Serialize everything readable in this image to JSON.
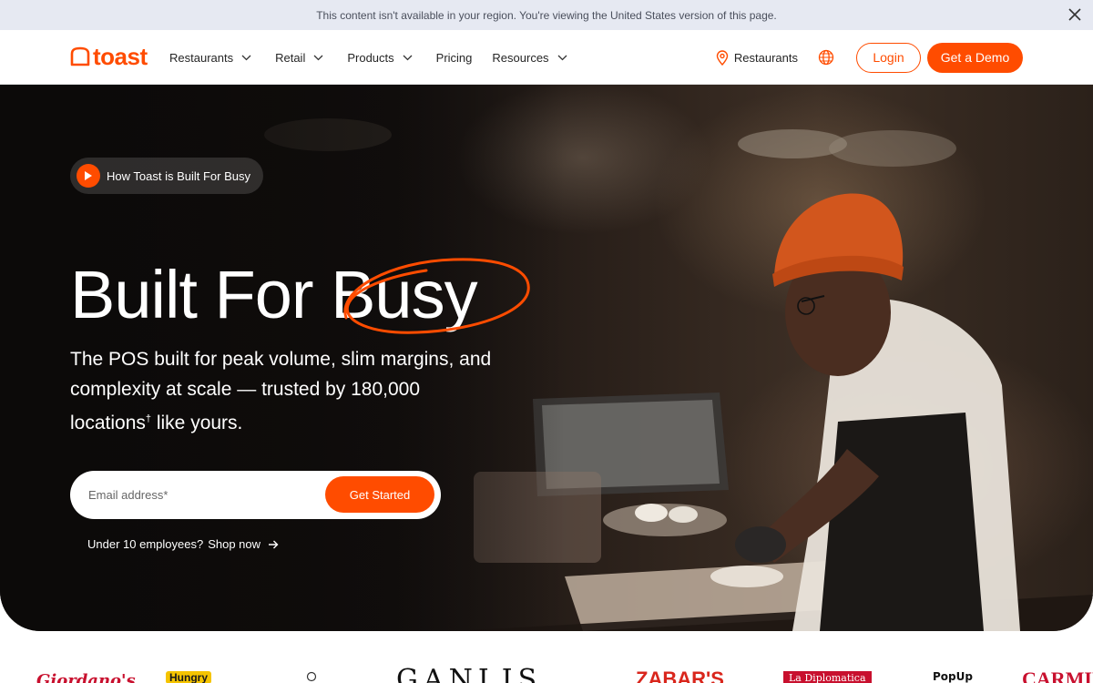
{
  "banner": {
    "text": "This content isn't available in your region. You're viewing the United States version of this page."
  },
  "header": {
    "logo_text": "toast",
    "nav": [
      {
        "label": "Restaurants",
        "dropdown": true
      },
      {
        "label": "Retail",
        "dropdown": true
      },
      {
        "label": "Products",
        "dropdown": true
      },
      {
        "label": "Pricing",
        "dropdown": false
      },
      {
        "label": "Resources",
        "dropdown": true
      }
    ],
    "location_label": "Restaurants",
    "login_label": "Login",
    "demo_label": "Get a Demo"
  },
  "hero": {
    "video_label": "How Toast is Built For Busy",
    "title_part1": "Built For ",
    "title_part2": "Busy",
    "subtitle": "The POS built for peak volume, slim margins, and complexity at scale — trusted by 180,000 locations",
    "subtitle_mark": "†",
    "subtitle_end": " like yours.",
    "email_placeholder": "Email address*",
    "cta_label": "Get Started",
    "small_biz_question": "Under 10 employees?",
    "small_biz_link": "Shop now"
  },
  "brands": [
    "Giordano's",
    "Hungry",
    "GANLIS",
    "ZABAR'S",
    "La Diplomatica",
    "PopUp",
    "CARMINE'S"
  ],
  "colors": {
    "accent": "#ff4c00",
    "banner_bg": "#e6e9f2",
    "hero_text": "#ffffff"
  }
}
